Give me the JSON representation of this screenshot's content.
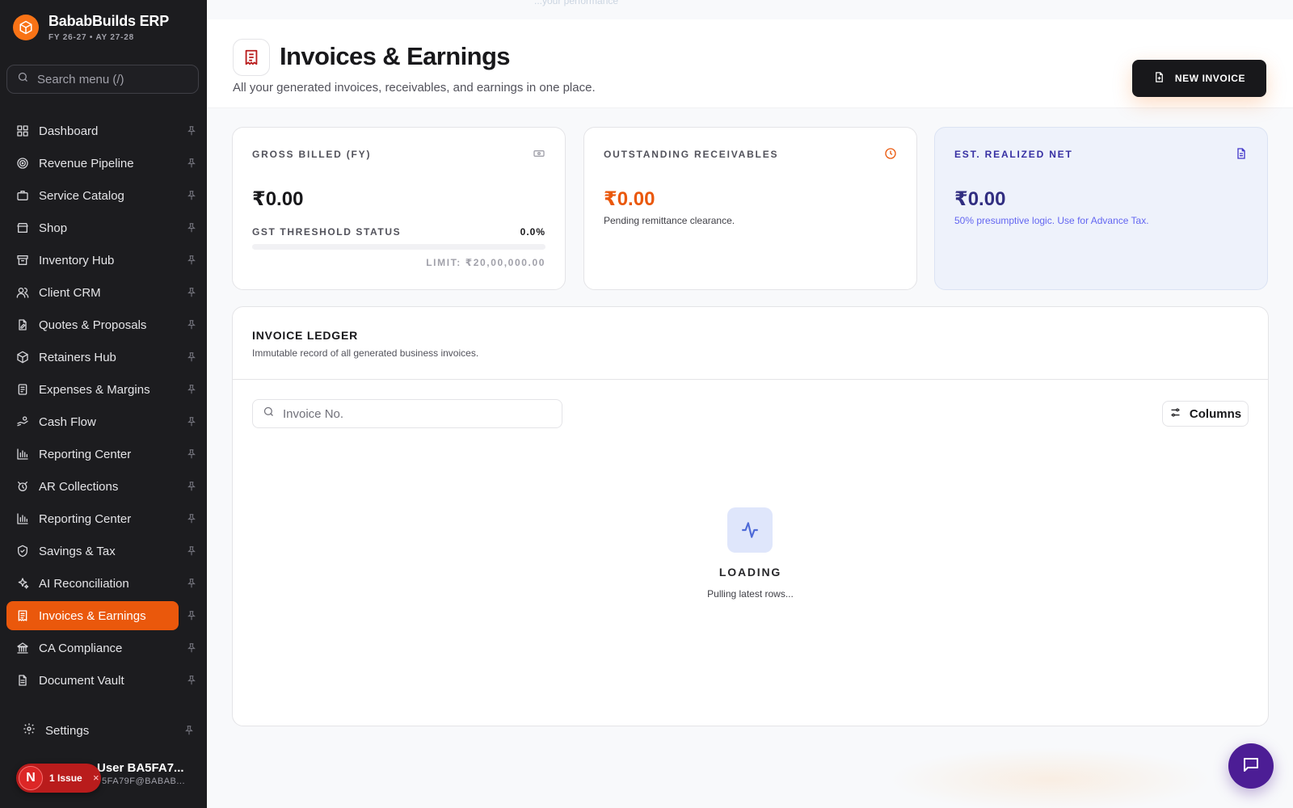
{
  "brand": {
    "name": "BababBuilds ERP",
    "fy": "FY 26-27 • AY 27-28"
  },
  "sidebar": {
    "search_placeholder": "Search menu (/)",
    "items": [
      {
        "label": "Dashboard",
        "icon": "dashboard-icon"
      },
      {
        "label": "Revenue Pipeline",
        "icon": "target-icon"
      },
      {
        "label": "Service Catalog",
        "icon": "briefcase-icon"
      },
      {
        "label": "Shop",
        "icon": "store-icon"
      },
      {
        "label": "Inventory Hub",
        "icon": "archive-icon"
      },
      {
        "label": "Client CRM",
        "icon": "users-icon"
      },
      {
        "label": "Quotes & Proposals",
        "icon": "file-edit-icon"
      },
      {
        "label": "Retainers Hub",
        "icon": "package-icon"
      },
      {
        "label": "Expenses & Margins",
        "icon": "receipt-icon"
      },
      {
        "label": "Cash Flow",
        "icon": "hand-coins-icon"
      },
      {
        "label": "Reporting Center",
        "icon": "bar-chart-icon"
      },
      {
        "label": "AR Collections",
        "icon": "alarm-icon"
      },
      {
        "label": "Reporting Center",
        "icon": "bar-chart-icon"
      },
      {
        "label": "Savings & Tax",
        "icon": "shield-icon"
      },
      {
        "label": "AI Reconciliation",
        "icon": "sparkles-icon"
      },
      {
        "label": "Invoices & Earnings",
        "icon": "invoice-icon",
        "active": true
      },
      {
        "label": "CA Compliance",
        "icon": "landmark-icon"
      },
      {
        "label": "Document Vault",
        "icon": "document-icon"
      }
    ],
    "settings_label": "Settings",
    "user": {
      "name": "User BA5FA7...",
      "email": "5FA79F@BABAB...",
      "avatar_letter": "N",
      "issue_label": "1 Issue",
      "issue_close": "×"
    }
  },
  "header": {
    "faint_text": "...your performance",
    "title": "Invoices & Earnings",
    "subtitle": "All your generated invoices, receivables, and earnings in one place.",
    "new_invoice_label": "NEW INVOICE"
  },
  "cards": {
    "gross": {
      "label": "GROSS BILLED (FY)",
      "value": "₹0.00",
      "gst_label": "GST THRESHOLD STATUS",
      "gst_pct": "0.0%",
      "gst_progress": 0.0,
      "limit": "LIMIT: ₹20,00,000.00"
    },
    "outstanding": {
      "label": "OUTSTANDING RECEIVABLES",
      "value": "₹0.00",
      "note": "Pending remittance clearance."
    },
    "net": {
      "label": "EST. REALIZED NET",
      "value": "₹0.00",
      "note": "50% presumptive logic. Use for Advance Tax."
    }
  },
  "ledger": {
    "title": "INVOICE LEDGER",
    "subtitle": "Immutable record of all generated business invoices.",
    "search_placeholder": "Invoice No.",
    "columns_label": "Columns",
    "loading_title": "LOADING",
    "loading_sub": "Pulling latest rows..."
  },
  "colors": {
    "accent": "#ea580c",
    "sidebar_bg": "#1c1c1f",
    "fab": "#4c1d95"
  }
}
